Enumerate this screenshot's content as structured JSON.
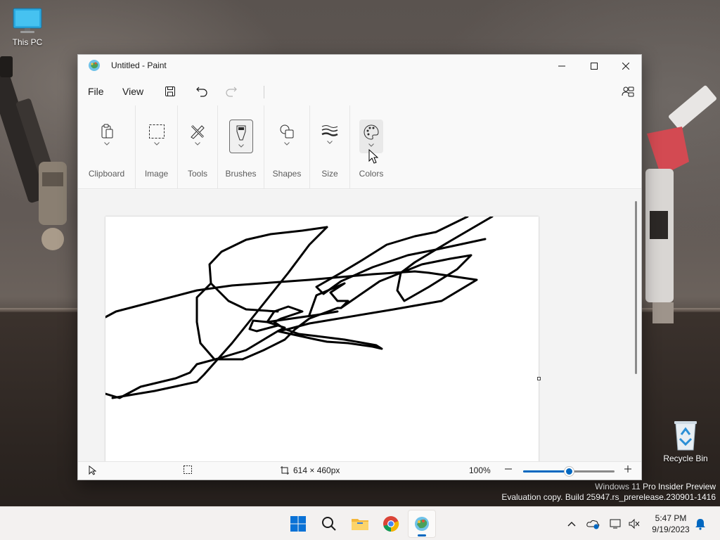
{
  "desktop": {
    "icons": [
      {
        "label": "This PC",
        "icon": "monitor-icon"
      },
      {
        "label": "Recycle Bin",
        "icon": "recycle-bin-icon"
      }
    ],
    "watermark": {
      "line1": "Windows 11 Pro Insider Preview",
      "line2": "Evaluation copy. Build 25947.rs_prerelease.230901-1416"
    }
  },
  "window": {
    "title": "Untitled - Paint",
    "menu": {
      "file": "File",
      "view": "View"
    },
    "ribbon": {
      "groups": [
        {
          "label": "Clipboard",
          "icon": "clipboard-icon"
        },
        {
          "label": "Image",
          "icon": "selection-icon"
        },
        {
          "label": "Tools",
          "icon": "tools-icon"
        },
        {
          "label": "Brushes",
          "icon": "brush-icon",
          "selected": true
        },
        {
          "label": "Shapes",
          "icon": "shapes-icon"
        },
        {
          "label": "Size",
          "icon": "size-icon"
        },
        {
          "label": "Colors",
          "icon": "palette-icon",
          "hover": true
        }
      ]
    },
    "status": {
      "canvas_size": "614 × 460px",
      "zoom": "100%",
      "zoom_level": 0.5
    },
    "colors": {
      "accent": "#0067c0",
      "stroke": "#000000"
    }
  },
  "taskbar": {
    "apps": [
      "start-icon",
      "search-icon",
      "file-explorer-icon",
      "chrome-icon",
      "paint-icon"
    ],
    "active_app": "paint-icon",
    "clock": {
      "time": "5:47 PM",
      "date": "9/19/2023"
    }
  }
}
